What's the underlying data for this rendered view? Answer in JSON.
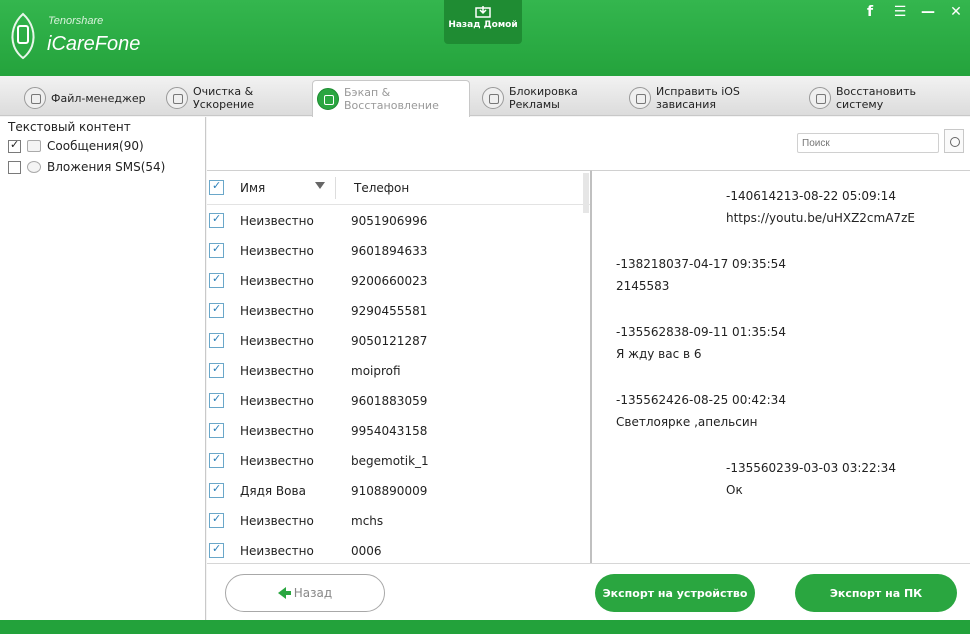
{
  "app": {
    "brand_small": "Tenorshare",
    "brand_big": "iCareFone"
  },
  "header": {
    "home_label": "Назад Домой"
  },
  "tabs": [
    {
      "label": "Файл-менеджер",
      "icon": "file-manager-icon"
    },
    {
      "label": "Очистка & Ускорение",
      "icon": "speedup-icon"
    },
    {
      "label": "Бэкап & Восстановление",
      "icon": "backup-icon",
      "active": true
    },
    {
      "label": "Блокировка Рекламы",
      "icon": "adblock-icon"
    },
    {
      "label": "Исправить iOS зависания",
      "icon": "repair-icon"
    },
    {
      "label": "Восстановить систему",
      "icon": "restore-icon"
    }
  ],
  "left": {
    "title": "Текстовый контент",
    "items": [
      {
        "label": "Сообщения(90)",
        "checked": true
      },
      {
        "label": "Вложения SMS(54)",
        "checked": false
      }
    ]
  },
  "search": {
    "placeholder": "Поиск"
  },
  "list": {
    "col_name": "Имя",
    "col_phone": "Телефон",
    "rows": [
      {
        "name": "Неизвестно",
        "phone": "9051906996"
      },
      {
        "name": "Неизвестно",
        "phone": "9601894633"
      },
      {
        "name": "Неизвестно",
        "phone": "9200660023"
      },
      {
        "name": "Неизвестно",
        "phone": "9290455581"
      },
      {
        "name": "Неизвестно",
        "phone": "9050121287"
      },
      {
        "name": "Неизвестно",
        "phone": "moiprofi"
      },
      {
        "name": "Неизвестно",
        "phone": "9601883059"
      },
      {
        "name": "Неизвестно",
        "phone": "9954043158"
      },
      {
        "name": "Неизвестно",
        "phone": "begemotik_1"
      },
      {
        "name": "Дядя Вова",
        "phone": "9108890009"
      },
      {
        "name": "Неизвестно",
        "phone": "mchs"
      },
      {
        "name": "Неизвестно",
        "phone": "0006"
      }
    ]
  },
  "messages": [
    {
      "time": "-140614213-08-22 05:09:14",
      "text": "https://youtu.be/uHXZ2cmA7zE",
      "side": "right"
    },
    {
      "time": "-138218037-04-17 09:35:54",
      "text": "2145583",
      "side": "left"
    },
    {
      "time": "-135562838-09-11 01:35:54",
      "text": "Я жду вас в 6",
      "side": "left"
    },
    {
      "time": "-135562426-08-25 00:42:34",
      "text": "Светлоярке ,апельсин",
      "side": "left"
    },
    {
      "time": "-135560239-03-03 03:22:34",
      "text": "Ок",
      "side": "right"
    }
  ],
  "buttons": {
    "back": "Назад",
    "export_device": "Экспорт на устройство",
    "export_pc": "Экспорт на ПК"
  },
  "colors": {
    "accent": "#2aa640",
    "header": "#2db146"
  }
}
